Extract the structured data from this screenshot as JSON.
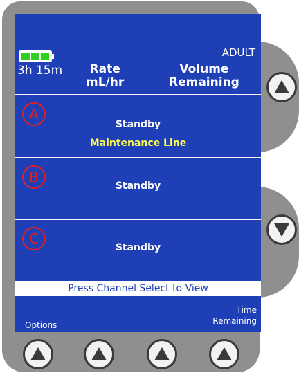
{
  "screen": {
    "battery_time": "3h 15m",
    "mode": "ADULT",
    "header": {
      "rate_line1": "Rate",
      "rate_line2": "mL/hr",
      "volume_line1": "Volume",
      "volume_line2": "Remaining"
    },
    "channels": [
      {
        "letter": "A",
        "status": "Standby",
        "line_label": "Maintenance Line"
      },
      {
        "letter": "B",
        "status": "Standby"
      },
      {
        "letter": "C",
        "status": "Standby"
      }
    ],
    "prompt": "Press Channel Select to View",
    "softkeys": {
      "options": "Options",
      "time_line1": "Time",
      "time_line2": "Remaining"
    }
  },
  "colors": {
    "screen_bg": "#1f3fb7",
    "channel_ring": "#e02020",
    "line_label": "#ffff55",
    "battery_cell": "#2fcf1f",
    "bezel": "#8f8f8f"
  },
  "icons": {
    "side_buttons": [
      "up-arrow-icon",
      "down-arrow-icon"
    ],
    "bottom_buttons": [
      "up-arrow-icon",
      "up-arrow-icon",
      "up-arrow-icon",
      "up-arrow-icon"
    ]
  }
}
